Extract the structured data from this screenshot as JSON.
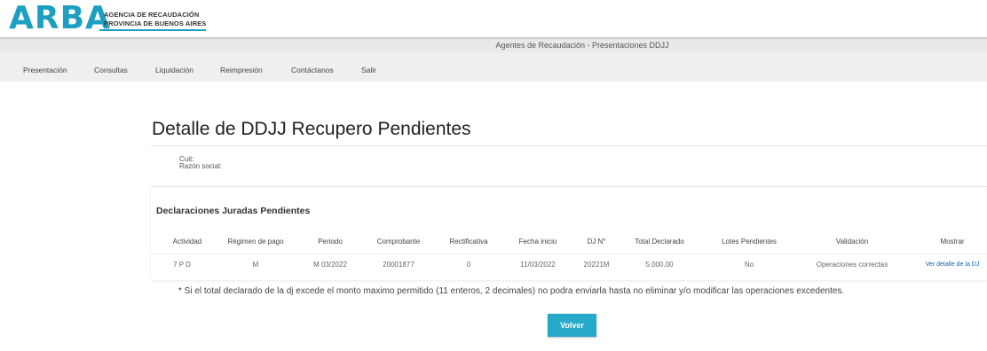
{
  "header": {
    "logo": "ARBA",
    "org_line1": "AGENCIA DE RECAUDACIÓN",
    "org_line2": "PROVINCIA DE BUENOS AIRES",
    "title": "Agentes de Recaudación - Presentaciones DDJJ"
  },
  "menu": [
    {
      "label": "Presentación"
    },
    {
      "label": "Consultas"
    },
    {
      "label": "Liquidación"
    },
    {
      "label": "Reimpresión"
    },
    {
      "label": "Contáctanos"
    },
    {
      "label": "Salir"
    }
  ],
  "page": {
    "title": "Detalle de DDJJ Recupero Pendientes",
    "cuit_label": "Cuit:",
    "razon_label": "Razón social:"
  },
  "panel": {
    "title": "Declaraciones Juradas Pendientes",
    "columns": [
      "Actividad",
      "Régimen de pago",
      "Periodo",
      "Comprobante",
      "Rectificativa",
      "Fecha inicio",
      "DJ N°",
      "Total Declarado",
      "Lotes Pendientes",
      "Validación",
      "Mostrar"
    ],
    "rows": [
      {
        "actividad": "7 P D",
        "regimen": "M",
        "periodo": "M 03/2022",
        "comprobante": "20001877",
        "rectificativa": "0",
        "fecha_inicio": "11/03/2022",
        "dj_nro": "20221M",
        "total": "5.000,00",
        "lotes": "No",
        "validacion": "Operaciones correctas",
        "mostrar": "Ver detalle de la DJ"
      }
    ]
  },
  "note": "* Si el total declarado de la dj excede el monto maximo permitido (11 enteros, 2 decimales) no podra enviarla hasta no eliminar y/o modificar las operaciones excedentes.",
  "actions": {
    "back_label": "Volver"
  },
  "colors": {
    "brand": "#1d9fc2",
    "button": "#27a9c9",
    "link": "#1a5fb4"
  }
}
